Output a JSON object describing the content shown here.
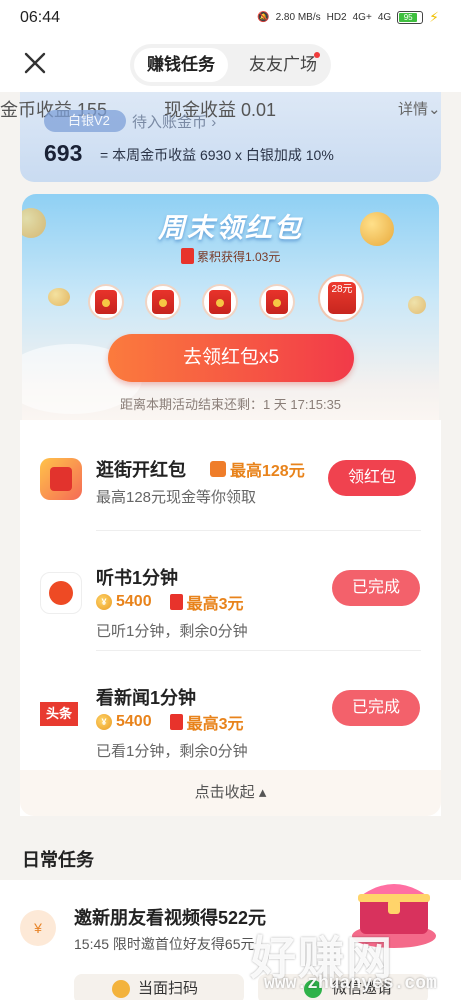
{
  "status_bar": {
    "time": "06:44",
    "network_speed": "2.80 MB/s",
    "hd": "HD2",
    "signal1": "4G+",
    "signal2": "4G",
    "battery": "95"
  },
  "header": {
    "tabs": [
      {
        "label": "赚钱任务",
        "active": true
      },
      {
        "label": "友友广场",
        "active": false
      }
    ]
  },
  "earnings": {
    "coin_label": "金币收益 155",
    "cash_label": "现金收益 0.01",
    "detail_link": "详情",
    "silver_badge": "白银V2",
    "pending_text": "待入账金币",
    "coin_total": "693",
    "formula": "= 本周金币收益 6930  x  白银加成 10%"
  },
  "weekend": {
    "title": "周末领红包",
    "accum_text": "累积获得1.03元",
    "big_packet_label": "28元",
    "claim_button": "去领红包x5",
    "countdown": "距离本期活动结束还剩：1 天 17:15:35"
  },
  "tasks": [
    {
      "title": "逛街开红包",
      "tag": "最高128元",
      "sub": "最高128元现金等你领取",
      "button": "领红包"
    },
    {
      "title": "听书1分钟",
      "coins": "5400",
      "tag": "最高3元",
      "sub": "已听1分钟，剩余0分钟",
      "button": "已完成"
    },
    {
      "title": "看新闻1分钟",
      "coins": "5400",
      "tag": "最高3元",
      "sub": "已看1分钟，剩余0分钟",
      "button": "已完成",
      "icon_text": "头条"
    }
  ],
  "collapse_label": "点击收起",
  "daily": {
    "section_title": "日常任务",
    "invite_title": "邀新朋友看视频得522元",
    "invite_sub": "15:45 限时邀首位好友得65元",
    "scan_label": "当面扫码",
    "wechat_label": "微信邀请"
  },
  "watermark": {
    "text": "好赚网",
    "url": "www.zhuanyes.com"
  }
}
